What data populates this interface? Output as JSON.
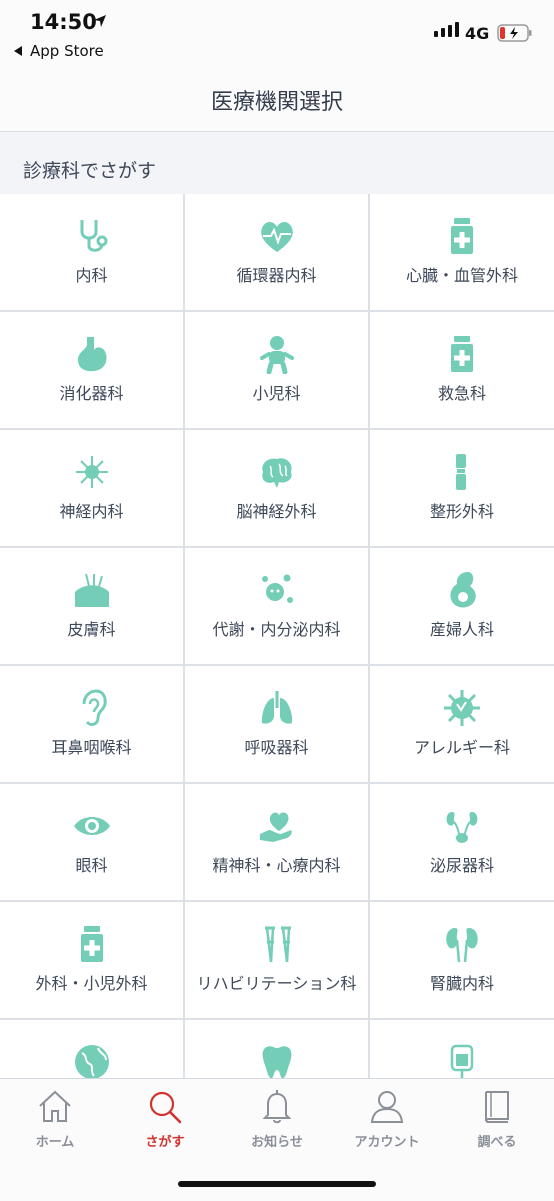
{
  "status_bar": {
    "time": "14:50",
    "back_label": "App Store",
    "network": "4G"
  },
  "nav": {
    "title": "医療機関選択"
  },
  "section": {
    "title": "診療科でさがす"
  },
  "departments": [
    {
      "label": "内科",
      "icon": "stethoscope-icon"
    },
    {
      "label": "循環器内科",
      "icon": "heart-pulse-icon"
    },
    {
      "label": "心臓・血管外科",
      "icon": "medicine-bottle-icon"
    },
    {
      "label": "消化器科",
      "icon": "stomach-icon"
    },
    {
      "label": "小児科",
      "icon": "baby-icon"
    },
    {
      "label": "救急科",
      "icon": "medicine-bottle-icon"
    },
    {
      "label": "神経内科",
      "icon": "neuron-icon"
    },
    {
      "label": "脳神経外科",
      "icon": "brain-icon"
    },
    {
      "label": "整形外科",
      "icon": "bone-joint-icon"
    },
    {
      "label": "皮膚科",
      "icon": "skin-hair-icon"
    },
    {
      "label": "代謝・内分泌内科",
      "icon": "cells-icon"
    },
    {
      "label": "産婦人科",
      "icon": "pregnancy-icon"
    },
    {
      "label": "耳鼻咽喉科",
      "icon": "ear-icon"
    },
    {
      "label": "呼吸器科",
      "icon": "lungs-icon"
    },
    {
      "label": "アレルギー科",
      "icon": "virus-icon"
    },
    {
      "label": "眼科",
      "icon": "eye-icon"
    },
    {
      "label": "精神科・心療内科",
      "icon": "heart-hand-icon"
    },
    {
      "label": "泌尿器科",
      "icon": "kidney-bladder-icon"
    },
    {
      "label": "外科・小児外科",
      "icon": "medicine-bottle-icon"
    },
    {
      "label": "リハビリテーション科",
      "icon": "crutches-icon"
    },
    {
      "label": "腎臓内科",
      "icon": "kidneys-icon"
    },
    {
      "label": "",
      "icon": "globe-icon"
    },
    {
      "label": "",
      "icon": "tooth-icon"
    },
    {
      "label": "",
      "icon": "iv-bag-icon"
    }
  ],
  "tabs": [
    {
      "label": "ホーム",
      "icon": "home-icon",
      "active": false
    },
    {
      "label": "さがす",
      "icon": "search-icon",
      "active": true
    },
    {
      "label": "お知らせ",
      "icon": "bell-icon",
      "active": false
    },
    {
      "label": "アカウント",
      "icon": "person-icon",
      "active": false
    },
    {
      "label": "調べる",
      "icon": "book-icon",
      "active": false
    }
  ],
  "colors": {
    "icon_teal": "#74cdb6",
    "active_tab": "#d2322d",
    "inactive_tab": "#8a8f98",
    "battery_low": "#e0342d"
  }
}
